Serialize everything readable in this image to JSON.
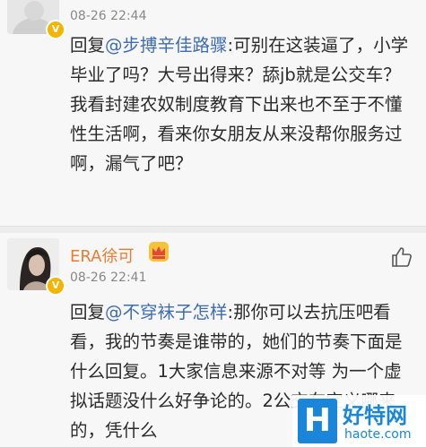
{
  "comments": [
    {
      "time": "08-26 22:44",
      "badge": "V",
      "reply_prefix": "回复",
      "mention": "@步搏辛佳路骤",
      "text": ":可别在这装逼了，小学毕业了吗？大号出得来？舔jb就是公交车？我看封建农奴制度教育下出来也不至于不懂性生活啊，看来你女朋友从来没帮你服务过啊，漏气了吧？"
    },
    {
      "name": "ERA徐可",
      "time": "08-26 22:41",
      "badge": "V",
      "reply_prefix": "回复",
      "mention": "@不穿袜子怎样",
      "text": ":那你可以去抗压吧看看，我的节奏是谁带的，她们的节奏下面是什么回复。1大家信息来源不对等 为一个虚拟话题没什么好争论的。2公交车定义哪来的，凭什么"
    }
  ],
  "watermark": {
    "logo_letter": "H",
    "title": "好特网",
    "url": "haote.com"
  }
}
